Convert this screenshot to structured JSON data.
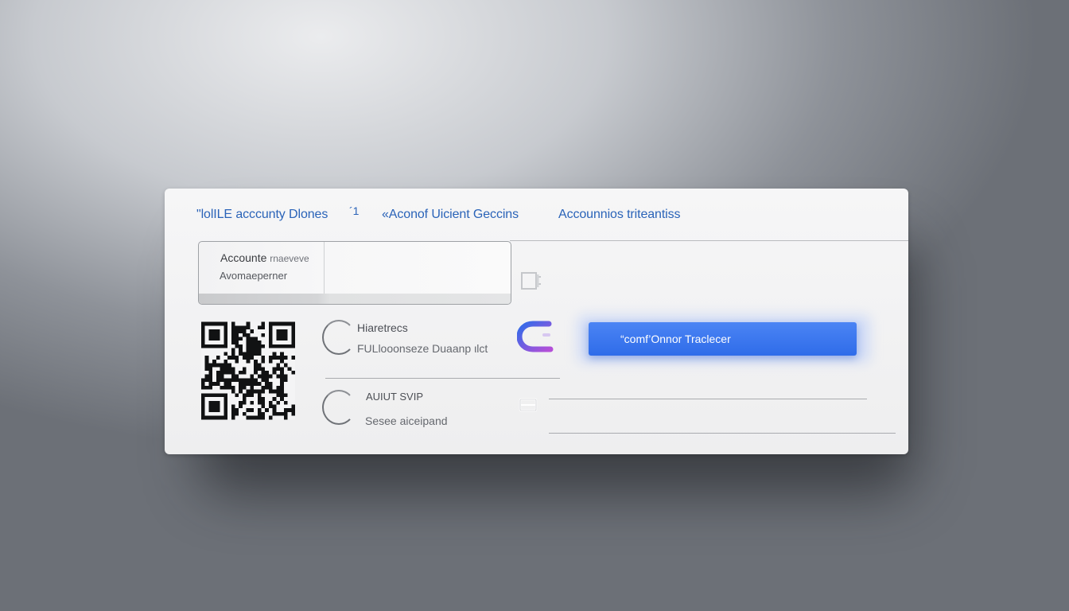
{
  "tabs": [
    {
      "label": "\"lolILE acccunty Dlones"
    },
    {
      "label": "´1"
    },
    {
      "label": "«Aconof Uicient Geccins"
    },
    {
      "label": "Accounnios triteantiss"
    }
  ],
  "account_box": {
    "line1": "Accounte",
    "line1_faint": "rnaeveve",
    "line2": "Avomaeperner"
  },
  "options": [
    {
      "title": "Hiaretrecs",
      "subtitle": "FULlooonseze Duaanp ιlct"
    },
    {
      "title": "AUIUT SVIP",
      "subtitle": "Sesee aiceipand"
    }
  ],
  "confirm_button": {
    "label": "“comf’Onnor Traclecer"
  },
  "colors": {
    "tab_text": "#2a63b8",
    "button_blue": "#3a74ee",
    "brand_icon_gradient": [
      "#2f6ce9",
      "#b44fd8"
    ]
  },
  "icons": [
    "document-icon",
    "qr-code-icon",
    "brand-icon",
    "card-icon"
  ]
}
